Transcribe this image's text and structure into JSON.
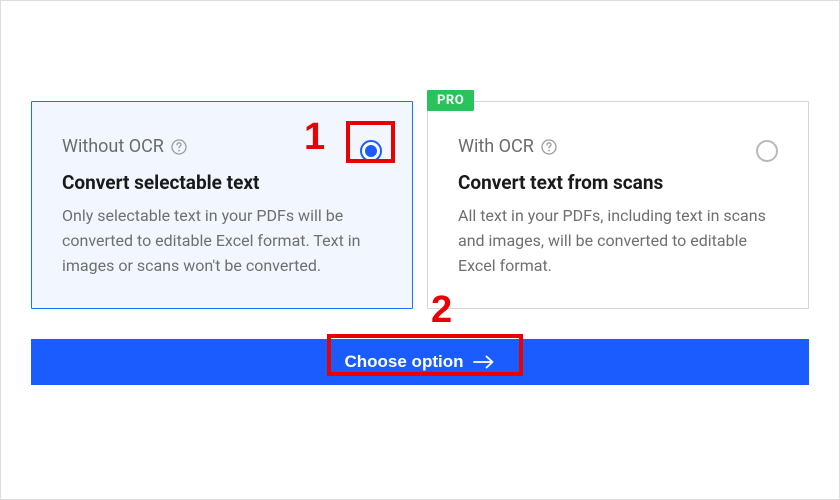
{
  "options": {
    "without_ocr": {
      "label": "Without OCR",
      "title": "Convert selectable text",
      "desc": "Only selectable text in your PDFs will be converted to editable Excel format. Text in images or scans won't be converted."
    },
    "with_ocr": {
      "label": "With OCR",
      "title": "Convert text from scans",
      "desc": "All text in your PDFs, including text in scans and images, will be converted to editable Excel format.",
      "pro_badge": "PRO"
    }
  },
  "cta": {
    "label": "Choose option"
  },
  "annotations": {
    "num1": "1",
    "num2": "2"
  }
}
